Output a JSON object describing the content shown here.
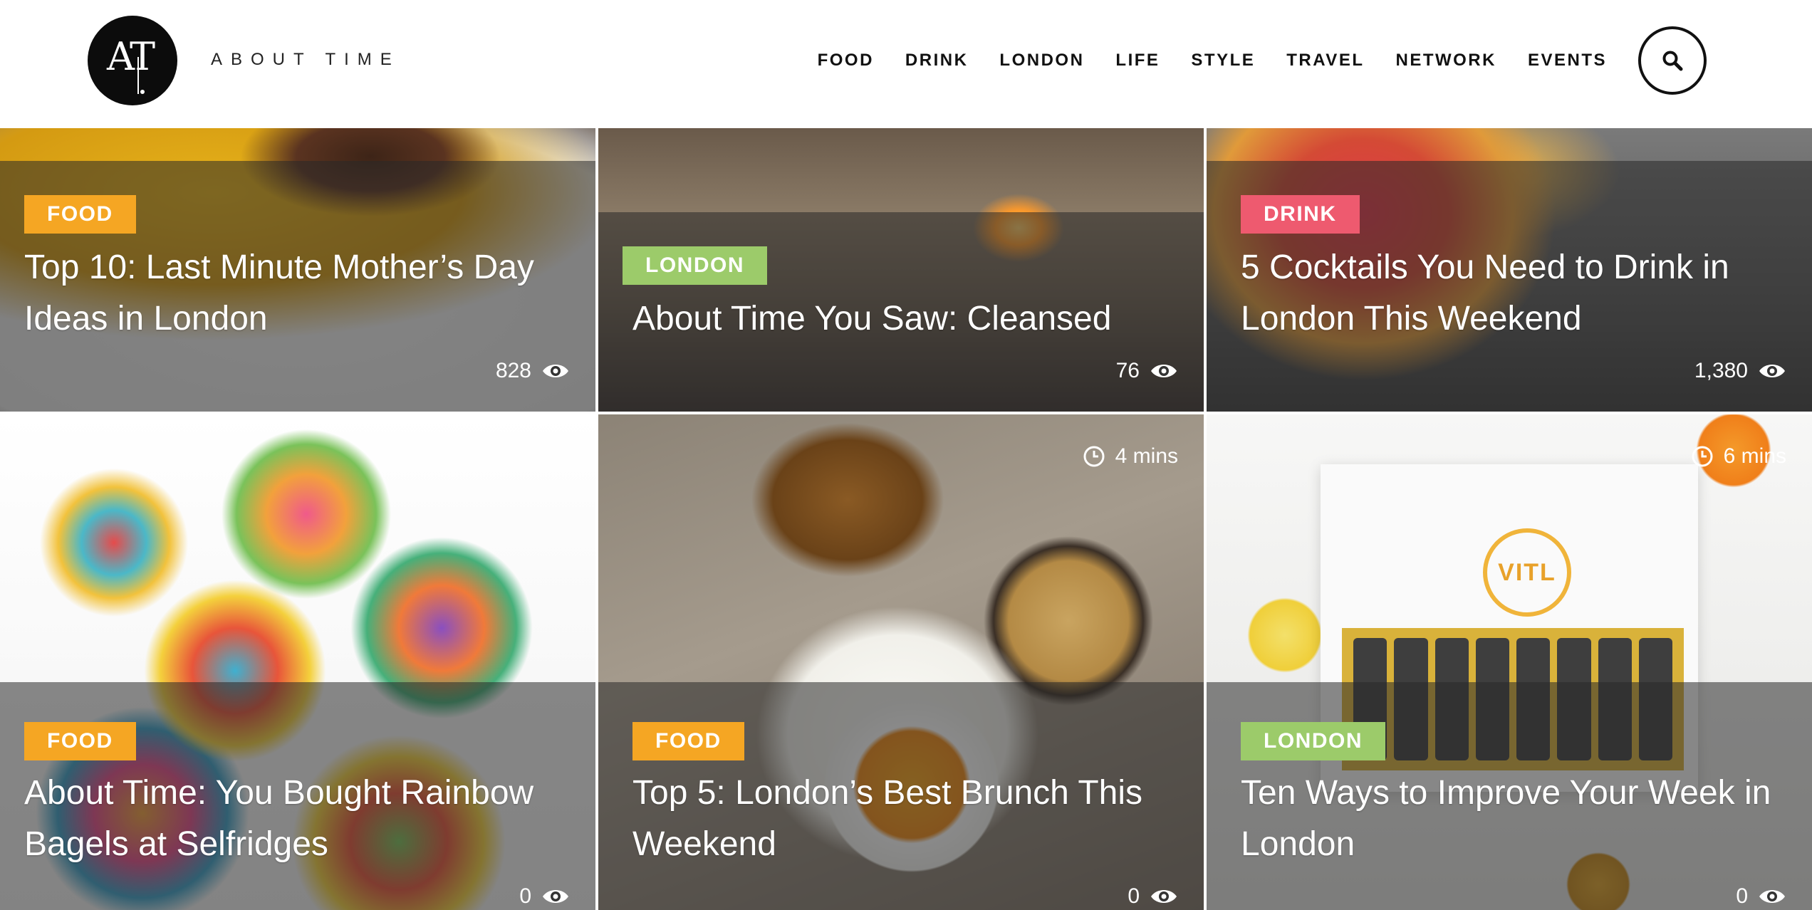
{
  "header": {
    "logo_text": "AT",
    "brand": "ABOUT TIME",
    "nav": [
      "FOOD",
      "DRINK",
      "LONDON",
      "LIFE",
      "STYLE",
      "TRAVEL",
      "NETWORK",
      "EVENTS"
    ],
    "search_icon": "search-icon"
  },
  "colors": {
    "food": "#f5a623",
    "london": "#9ccb6a",
    "drink": "#ee5a6f"
  },
  "cards": [
    {
      "category": "FOOD",
      "title": "Top 10: Last Minute Mother’s Day Ideas in London",
      "views": "828"
    },
    {
      "category": "LONDON",
      "title": "About Time You Saw: Cleansed",
      "views": "76"
    },
    {
      "category": "DRINK",
      "title": "5 Cocktails You Need to Drink in London This Weekend",
      "views": "1,380"
    },
    {
      "category": "FOOD",
      "title": "About Time: You Bought Rainbow Bagels at Selfridges",
      "views": "0"
    },
    {
      "category": "FOOD",
      "title": "Top 5: London’s Best Brunch This Weekend",
      "views": "0",
      "read_time": "4 mins"
    },
    {
      "category": "LONDON",
      "title": "Ten Ways to Improve Your Week in London",
      "views": "0",
      "read_time": "6 mins",
      "product_logo": "VITL"
    }
  ]
}
